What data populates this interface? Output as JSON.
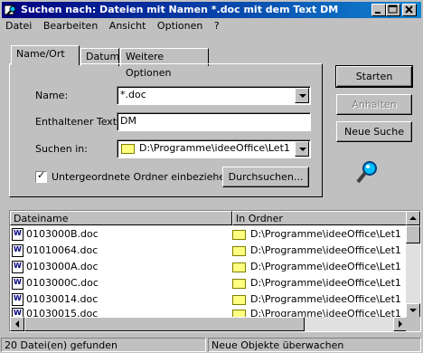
{
  "window": {
    "title": "Suchen nach: Dateien mit Namen *.doc mit dem Text DM"
  },
  "menu": [
    "Datei",
    "Bearbeiten",
    "Ansicht",
    "Optionen",
    "?"
  ],
  "tabs": [
    "Name/Ort",
    "Datum",
    "Weitere Optionen"
  ],
  "form": {
    "name_label": "Name:",
    "name_value": "*.doc",
    "text_label": "Enthaltener Text:",
    "text_value": "DM",
    "search_in_label": "Suchen in:",
    "search_in_value": "D:\\Programme\\ideeOffice\\Let1",
    "subfolders_label": "Untergeordnete Ordner einbeziehen",
    "subfolders_checked": true,
    "browse_button": "Durchsuchen..."
  },
  "buttons": {
    "start": "Starten",
    "stop": "Anhalten",
    "new_search": "Neue Suche"
  },
  "results": {
    "columns": [
      "Dateiname",
      "In Ordner"
    ],
    "rows": [
      {
        "name": "0103000B.doc",
        "folder": "D:\\Programme\\ideeOffice\\Let1"
      },
      {
        "name": "01010064.doc",
        "folder": "D:\\Programme\\ideeOffice\\Let1"
      },
      {
        "name": "0103000A.doc",
        "folder": "D:\\Programme\\ideeOffice\\Let1"
      },
      {
        "name": "0103000C.doc",
        "folder": "D:\\Programme\\ideeOffice\\Let1"
      },
      {
        "name": "01030014.doc",
        "folder": "D:\\Programme\\ideeOffice\\Let1"
      },
      {
        "name": "01030015.doc",
        "folder": "D:\\Programme\\ideeOffice\\Let1"
      }
    ]
  },
  "status": {
    "found": "20 Datei(en) gefunden",
    "monitor": "Neue Objekte überwachen"
  },
  "colors": {
    "titlebar": "#000080",
    "face": "#c0c0c0"
  }
}
